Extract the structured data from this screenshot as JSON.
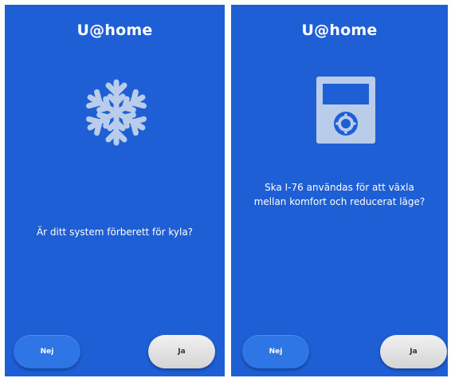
{
  "colors": {
    "screen_bg": "#1f5fd6",
    "button_no": "#2e76e6",
    "button_yes": "#e3e3e3",
    "icon": "#b9cdeb"
  },
  "screens": [
    {
      "title": "U@home",
      "icon": "snowflake-icon",
      "question": "Är ditt system förberett för kyla?",
      "no_label": "Nej",
      "yes_label": "Ja"
    },
    {
      "title": "U@home",
      "icon": "thermostat-device-icon",
      "question": "Ska I-76 användas för att växla mellan komfort och reducerat läge?",
      "no_label": "Nej",
      "yes_label": "Ja"
    }
  ]
}
